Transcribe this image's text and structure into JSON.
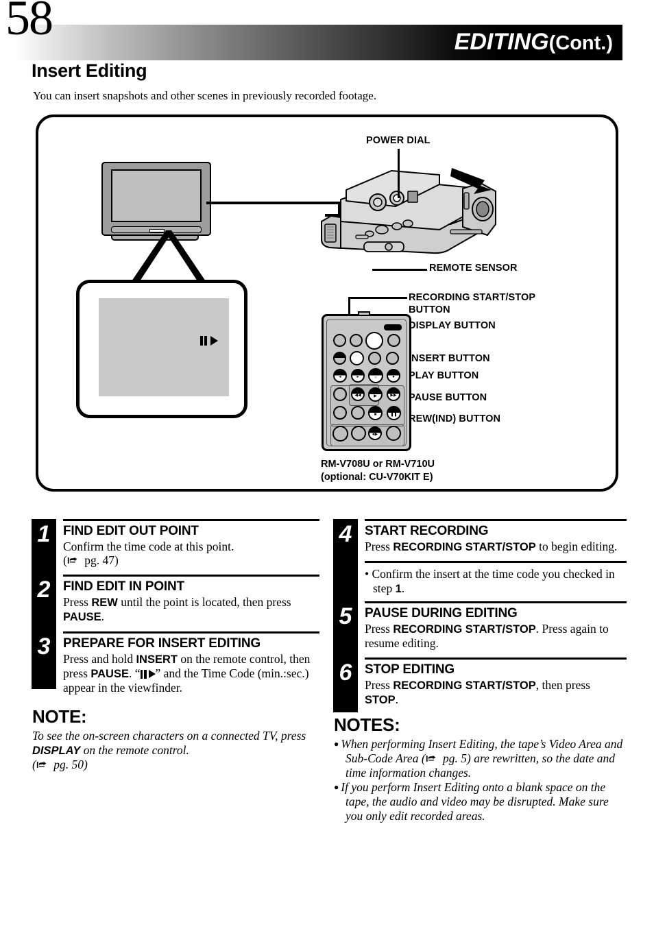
{
  "header": {
    "page_number": "58",
    "title": "EDITING",
    "title_suffix": "(Cont.)"
  },
  "section": {
    "title": "Insert Editing",
    "intro": "You can insert snapshots and other scenes in previously recorded footage."
  },
  "diagram": {
    "labels": {
      "power_dial": "POWER DIAL",
      "remote_sensor": "REMOTE SENSOR",
      "recording_start_stop": "RECORDING START/STOP BUTTON",
      "display_button": "DISPLAY BUTTON",
      "insert_button": "INSERT BUTTON",
      "play_button": "PLAY BUTTON",
      "pause_button": "PAUSE BUTTON",
      "rew_ind_button": "REW(IND) BUTTON"
    },
    "remote_model_line1": "RM-V708U or RM-V710U",
    "remote_model_line2": "(optional: CU-V70KIT E)",
    "osd_indicator": "pause-play-indicator"
  },
  "steps_left": [
    {
      "num": "1",
      "title": "FIND EDIT OUT POINT",
      "body_html": "Confirm the time code at this point.<br>(<span class=\"handicon\" data-name=\"pointing-hand-icon\" data-interactable=\"false\"></span> pg. 47)"
    },
    {
      "num": "2",
      "title": "FIND EDIT IN POINT",
      "body_html": "Press <b>REW</b> until the point is located, then press <b>PAUSE</b>."
    },
    {
      "num": "3",
      "title": "PREPARE FOR INSERT EDITING",
      "body_html": "Press and hold <b>INSERT</b> on the remote control, then press <b>PAUSE</b>. “<span class=\"inline-osd\"></span>” and the Time Code (min.:sec.) appear in the viewfinder."
    }
  ],
  "steps_right": [
    {
      "num": "4",
      "title": "START RECORDING",
      "body_html": "Press <b>RECORDING START/STOP</b> to begin editing."
    },
    {
      "num": "5",
      "title": "PAUSE DURING EDITING",
      "body_html": "Press <b>RECORDING START/STOP</b>. Press again to resume editing."
    },
    {
      "num": "6",
      "title": "STOP EDITING",
      "body_html": "Press <b>RECORDING START/STOP</b>, then press <b>STOP</b>."
    }
  ],
  "right_bullet": {
    "text_html": "• Confirm the insert at the time code you checked in step <b>1</b>."
  },
  "note_left": {
    "heading": "NOTE:",
    "body_html": "To see the on-screen characters on a connected TV, press <b>DISPLAY</b> on the remote control.<br>(<span class=\"handicon\" data-name=\"pointing-hand-icon\" data-interactable=\"false\"></span> pg. 50)"
  },
  "notes_right": {
    "heading": "NOTES:",
    "items_html": [
      "When performing Insert Editing, the tape’s Video Area and Sub-Code Area (<span class=\"handicon\" data-name=\"pointing-hand-icon\" data-interactable=\"false\"></span> pg. 5) are rewritten, so the date and time information changes.",
      "If you perform Insert Editing onto a blank space on the tape, the audio and video may be disrupted. Make sure you only edit recorded areas."
    ]
  },
  "colors": {
    "ink": "#000000",
    "screen_grey": "#c9c9c9",
    "device_grey": "#c0c0c0",
    "tv_grey": "#9d9d9d"
  }
}
